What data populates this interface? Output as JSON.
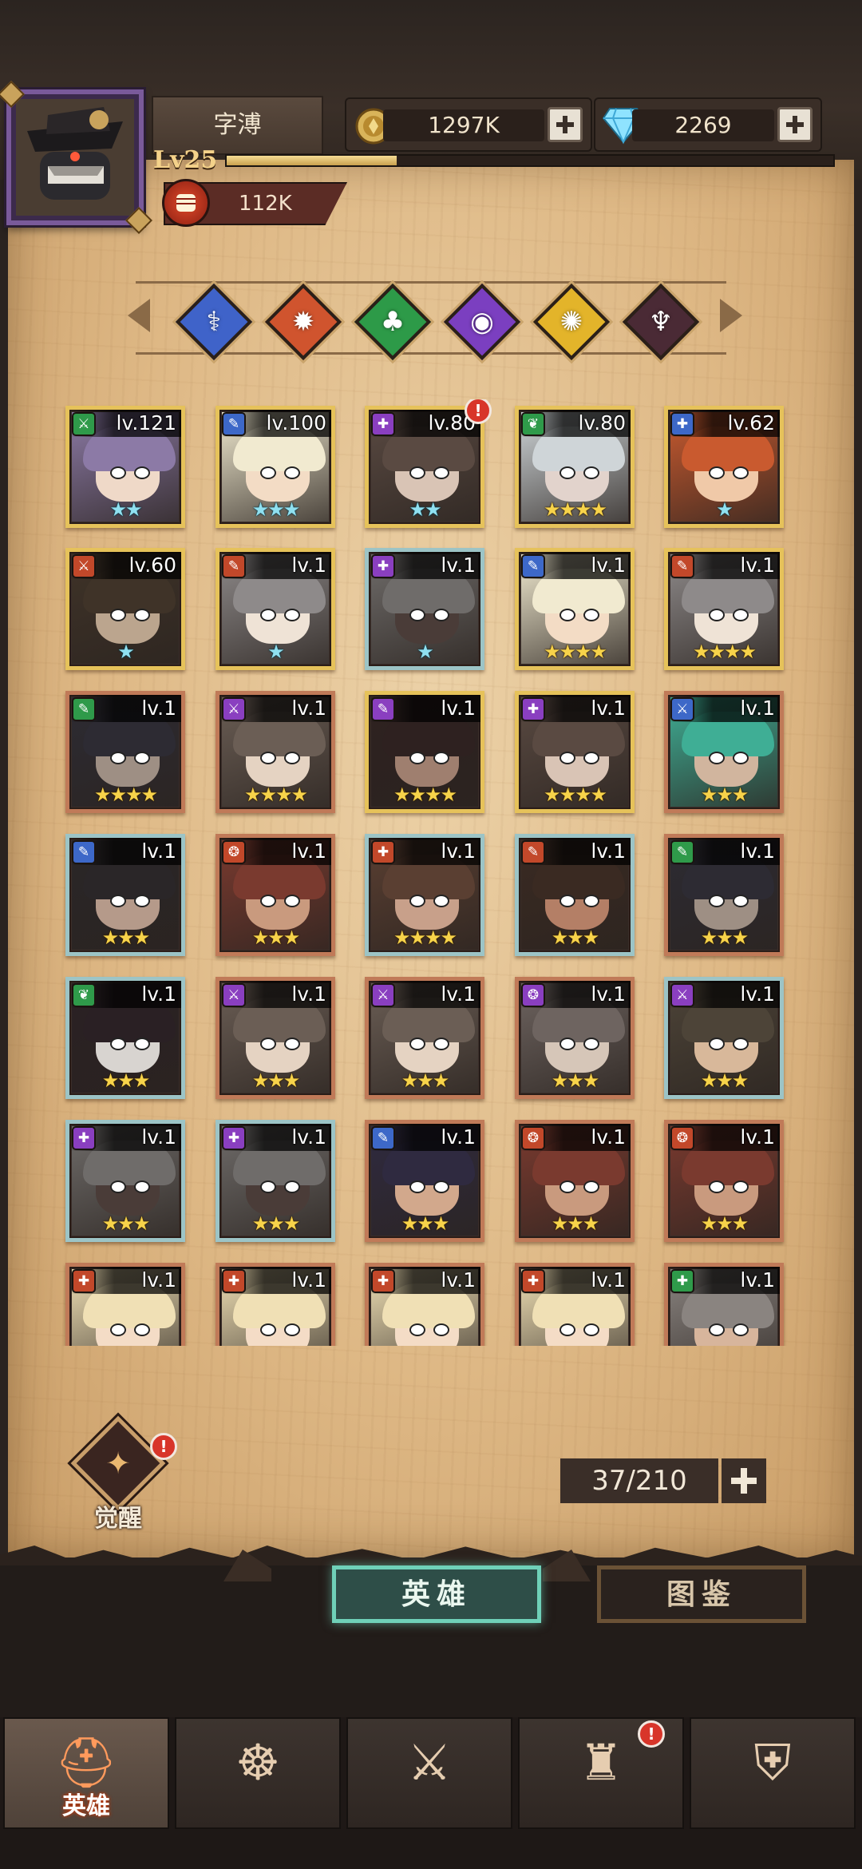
{
  "player": {
    "name": "字溥",
    "level": "Lv25",
    "xp_progress": 0.28,
    "power": "112K",
    "avatar_icon": "masked-hat-hero-portrait"
  },
  "currencies": [
    {
      "id": "gold",
      "icon": "gold-coin-icon",
      "value": "1297K"
    },
    {
      "id": "diamond",
      "icon": "diamond-icon",
      "value": "2269"
    }
  ],
  "factions": [
    {
      "id": "blue",
      "icon": "winged-staff-icon",
      "color": "#3f63c9",
      "glyph": "⚕"
    },
    {
      "id": "orange",
      "icon": "sun-wheel-icon",
      "color": "#d0542e",
      "glyph": "✹"
    },
    {
      "id": "green",
      "icon": "clover-icon",
      "color": "#2d9a48",
      "glyph": "♣"
    },
    {
      "id": "purple",
      "icon": "eye-icon",
      "color": "#7b3fc0",
      "glyph": "◉"
    },
    {
      "id": "gold",
      "icon": "sunburst-icon",
      "color": "#e3b42a",
      "glyph": "✺"
    },
    {
      "id": "dark",
      "icon": "demon-icon",
      "color": "#4a2a35",
      "glyph": "♆"
    }
  ],
  "class_colors": {
    "green": "#2f9a4a",
    "blue": "#3d68c8",
    "purple": "#8a3fc0",
    "red": "#c2482a"
  },
  "heroes": [
    {
      "level": "lv.121",
      "stars": 2,
      "star_color": "teal",
      "rank": "gold",
      "class": "green",
      "class_glyph": "⚔",
      "alert": false,
      "palette": [
        "#8c7aa6",
        "#efd9c8"
      ]
    },
    {
      "level": "lv.100",
      "stars": 3,
      "star_color": "teal",
      "rank": "gold",
      "class": "blue",
      "class_glyph": "✎",
      "alert": false,
      "palette": [
        "#f1ead0",
        "#f3dcc5"
      ]
    },
    {
      "level": "lv.80",
      "stars": 2,
      "star_color": "teal",
      "rank": "gold",
      "class": "purple",
      "class_glyph": "✚",
      "alert": true,
      "palette": [
        "#5a4a42",
        "#d9c4b5"
      ]
    },
    {
      "level": "lv.80",
      "stars": 4,
      "star_color": "gold",
      "rank": "gold",
      "class": "green",
      "class_glyph": "❦",
      "alert": false,
      "palette": [
        "#cfd5d8",
        "#e2d3cc"
      ]
    },
    {
      "level": "lv.62",
      "stars": 1,
      "star_color": "teal",
      "rank": "gold",
      "class": "blue",
      "class_glyph": "✚",
      "alert": false,
      "palette": [
        "#c95a2f",
        "#f0c9a8"
      ]
    },
    {
      "level": "lv.60",
      "stars": 1,
      "star_color": "teal",
      "rank": "gold",
      "class": "red",
      "class_glyph": "⚔",
      "alert": false,
      "palette": [
        "#3f3328",
        "#bba58e"
      ]
    },
    {
      "level": "lv.1",
      "stars": 1,
      "star_color": "teal",
      "rank": "gold",
      "class": "red",
      "class_glyph": "✎",
      "alert": false,
      "palette": [
        "#8e8a8a",
        "#efe3d6"
      ]
    },
    {
      "level": "lv.1",
      "stars": 1,
      "star_color": "teal",
      "rank": "teal",
      "class": "purple",
      "class_glyph": "✚",
      "alert": false,
      "palette": [
        "#6f6c6a",
        "#4a3c38"
      ]
    },
    {
      "level": "lv.1",
      "stars": 4,
      "star_color": "gold",
      "rank": "gold",
      "class": "blue",
      "class_glyph": "✎",
      "alert": false,
      "palette": [
        "#f1ead0",
        "#f3dcc5"
      ]
    },
    {
      "level": "lv.1",
      "stars": 4,
      "star_color": "gold",
      "rank": "gold",
      "class": "red",
      "class_glyph": "✎",
      "alert": false,
      "palette": [
        "#8e8a8a",
        "#efe3d6"
      ]
    },
    {
      "level": "lv.1",
      "stars": 4,
      "star_color": "gold",
      "rank": "copper",
      "class": "green",
      "class_glyph": "✎",
      "alert": false,
      "palette": [
        "#2d2b33",
        "#9e8f84"
      ]
    },
    {
      "level": "lv.1",
      "stars": 4,
      "star_color": "gold",
      "rank": "copper",
      "class": "purple",
      "class_glyph": "⚔",
      "alert": false,
      "palette": [
        "#6b5e55",
        "#e5d3c2"
      ]
    },
    {
      "level": "lv.1",
      "stars": 4,
      "star_color": "gold",
      "rank": "gold",
      "class": "purple",
      "class_glyph": "✎",
      "alert": false,
      "palette": [
        "#2e2120",
        "#9f7f6f"
      ]
    },
    {
      "level": "lv.1",
      "stars": 4,
      "star_color": "gold",
      "rank": "gold",
      "class": "purple",
      "class_glyph": "✚",
      "alert": false,
      "palette": [
        "#5a4a42",
        "#d9c4b5"
      ]
    },
    {
      "level": "lv.1",
      "stars": 3,
      "star_color": "gold",
      "rank": "copper",
      "class": "blue",
      "class_glyph": "⚔",
      "alert": false,
      "palette": [
        "#3fae95",
        "#d1b59e"
      ]
    },
    {
      "level": "lv.1",
      "stars": 3,
      "star_color": "gold",
      "rank": "teal",
      "class": "blue",
      "class_glyph": "✎",
      "alert": false,
      "palette": [
        "#2a2628",
        "#b59a8a"
      ]
    },
    {
      "level": "lv.1",
      "stars": 3,
      "star_color": "gold",
      "rank": "copper",
      "class": "red",
      "class_glyph": "❂",
      "alert": false,
      "palette": [
        "#7a3a2f",
        "#c99a7e"
      ]
    },
    {
      "level": "lv.1",
      "stars": 4,
      "star_color": "gold",
      "rank": "teal",
      "class": "red",
      "class_glyph": "✚",
      "alert": false,
      "palette": [
        "#5a3f32",
        "#c8a08a"
      ]
    },
    {
      "level": "lv.1",
      "stars": 3,
      "star_color": "gold",
      "rank": "teal",
      "class": "red",
      "class_glyph": "✎",
      "alert": false,
      "palette": [
        "#3a2a22",
        "#b47f66"
      ]
    },
    {
      "level": "lv.1",
      "stars": 3,
      "star_color": "gold",
      "rank": "copper",
      "class": "green",
      "class_glyph": "✎",
      "alert": false,
      "palette": [
        "#2d2b33",
        "#9e8f84"
      ]
    },
    {
      "level": "lv.1",
      "stars": 3,
      "star_color": "gold",
      "rank": "teal",
      "class": "green",
      "class_glyph": "❦",
      "alert": false,
      "palette": [
        "#2a2024",
        "#d8d4d0"
      ]
    },
    {
      "level": "lv.1",
      "stars": 3,
      "star_color": "gold",
      "rank": "copper",
      "class": "purple",
      "class_glyph": "⚔",
      "alert": false,
      "palette": [
        "#6b5e55",
        "#e5d3c2"
      ]
    },
    {
      "level": "lv.1",
      "stars": 3,
      "star_color": "gold",
      "rank": "copper",
      "class": "purple",
      "class_glyph": "⚔",
      "alert": false,
      "palette": [
        "#6b5e55",
        "#e5d3c2"
      ]
    },
    {
      "level": "lv.1",
      "stars": 3,
      "star_color": "gold",
      "rank": "copper",
      "class": "purple",
      "class_glyph": "❂",
      "alert": false,
      "palette": [
        "#6e6460",
        "#d6c6b8"
      ]
    },
    {
      "level": "lv.1",
      "stars": 3,
      "star_color": "gold",
      "rank": "teal",
      "class": "purple",
      "class_glyph": "⚔",
      "alert": false,
      "palette": [
        "#4d4438",
        "#d8b89a"
      ]
    },
    {
      "level": "lv.1",
      "stars": 3,
      "star_color": "gold",
      "rank": "teal",
      "class": "purple",
      "class_glyph": "✚",
      "alert": false,
      "palette": [
        "#6f6c6a",
        "#4a3c38"
      ]
    },
    {
      "level": "lv.1",
      "stars": 3,
      "star_color": "gold",
      "rank": "teal",
      "class": "purple",
      "class_glyph": "✚",
      "alert": false,
      "palette": [
        "#6f6c6a",
        "#4a3c38"
      ]
    },
    {
      "level": "lv.1",
      "stars": 3,
      "star_color": "gold",
      "rank": "copper",
      "class": "blue",
      "class_glyph": "✎",
      "alert": false,
      "palette": [
        "#2f2a40",
        "#d2a88c"
      ]
    },
    {
      "level": "lv.1",
      "stars": 3,
      "star_color": "gold",
      "rank": "copper",
      "class": "red",
      "class_glyph": "❂",
      "alert": false,
      "palette": [
        "#7a3a2f",
        "#c99a7e"
      ]
    },
    {
      "level": "lv.1",
      "stars": 3,
      "star_color": "gold",
      "rank": "copper",
      "class": "red",
      "class_glyph": "❂",
      "alert": false,
      "palette": [
        "#7a3a2f",
        "#c99a7e"
      ]
    },
    {
      "level": "lv.1",
      "stars": 0,
      "star_color": "gold",
      "rank": "copper",
      "class": "red",
      "class_glyph": "✚",
      "alert": false,
      "palette": [
        "#f0e0b5",
        "#f4dcc6"
      ]
    },
    {
      "level": "lv.1",
      "stars": 0,
      "star_color": "gold",
      "rank": "copper",
      "class": "red",
      "class_glyph": "✚",
      "alert": false,
      "palette": [
        "#f0e0b5",
        "#f4dcc6"
      ]
    },
    {
      "level": "lv.1",
      "stars": 0,
      "star_color": "gold",
      "rank": "copper",
      "class": "red",
      "class_glyph": "✚",
      "alert": false,
      "palette": [
        "#f0e0b5",
        "#f4dcc6"
      ]
    },
    {
      "level": "lv.1",
      "stars": 0,
      "star_color": "gold",
      "rank": "copper",
      "class": "red",
      "class_glyph": "✚",
      "alert": false,
      "palette": [
        "#f0e0b5",
        "#f4dcc6"
      ]
    },
    {
      "level": "lv.1",
      "stars": 0,
      "star_color": "gold",
      "rank": "copper",
      "class": "green",
      "class_glyph": "✚",
      "alert": false,
      "palette": [
        "#8a8480",
        "#d7b59c"
      ]
    }
  ],
  "awaken": {
    "label": "觉醒",
    "alert": "!"
  },
  "capacity": {
    "text": "37/210"
  },
  "section_tabs": {
    "heroes": "英雄",
    "codex": "图鉴"
  },
  "bottom_nav": [
    {
      "id": "heroes",
      "label": "英雄",
      "icon": "helmet-icon",
      "glyph": "⛑",
      "active": true,
      "alert": false
    },
    {
      "id": "voyage",
      "label": "",
      "icon": "ship-wheel-flag-icon",
      "glyph": "☸",
      "active": false,
      "alert": false
    },
    {
      "id": "battle",
      "label": "",
      "icon": "crossed-swords-icon",
      "glyph": "⚔",
      "active": false,
      "alert": false
    },
    {
      "id": "castle",
      "label": "",
      "icon": "castle-icon",
      "glyph": "♜",
      "active": false,
      "alert": true
    },
    {
      "id": "guild",
      "label": "",
      "icon": "guild-shield-icon",
      "glyph": "⛨",
      "active": false,
      "alert": false
    }
  ],
  "alert_mark": "!"
}
